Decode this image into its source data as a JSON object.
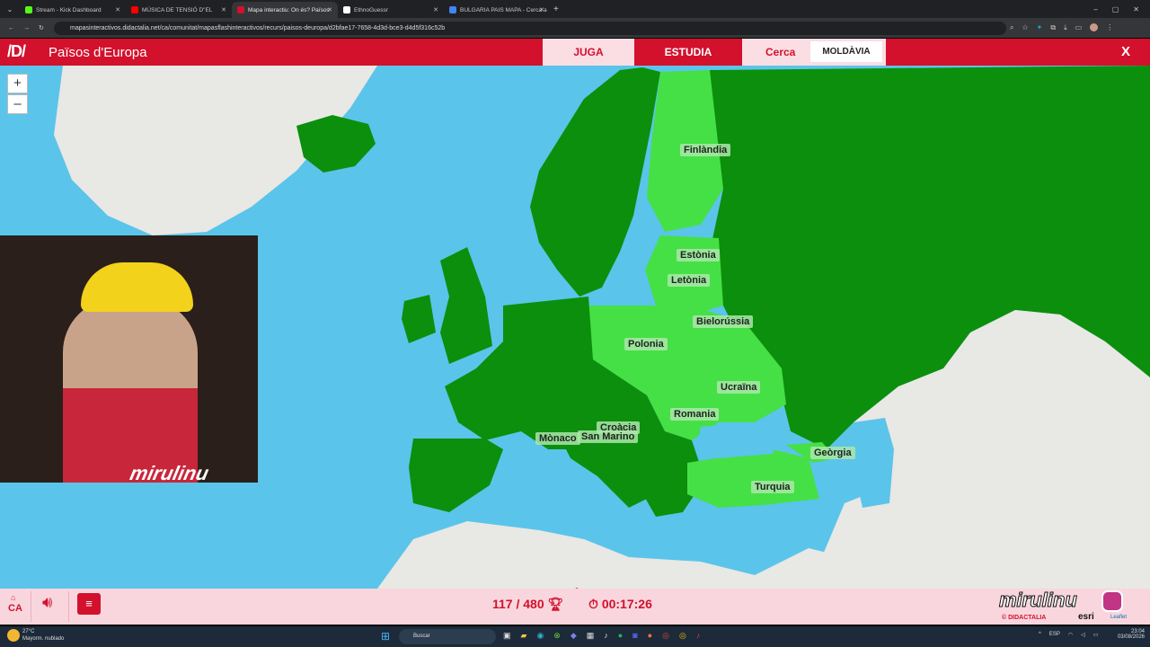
{
  "browser": {
    "tabs": [
      {
        "label": "Stream - Kick Dashboard",
        "color": "#53fc18",
        "active": false
      },
      {
        "label": "MÚSICA DE TENSIÓ D\"EL",
        "color": "#ff0000",
        "active": false
      },
      {
        "label": "Mapa interactiu: On és? Països",
        "color": "#d3112c",
        "active": true
      },
      {
        "label": "EthnoGuessr",
        "color": "#ffffff",
        "active": false
      },
      {
        "label": "BULGARIA PAIS MAPA - Cerca a",
        "color": "#4285f4",
        "active": false
      }
    ],
    "url": "mapasinteractivos.didactalia.net/ca/comunitat/mapasflashinteractivos/recurs/paisos-deuropa/d2bfae17-7658-4d3d-bce3-d4d5f316c52b"
  },
  "header": {
    "logo": "/D/",
    "title": "Països d'Europa",
    "play_label": "JUGA",
    "study_label": "ESTUDIA",
    "search_label": "Cerca",
    "search_value": "MOLDÀVIA",
    "close_label": "X"
  },
  "map": {
    "zoom_in": "+",
    "zoom_out": "–",
    "labels": [
      {
        "name": "Finlàndia"
      },
      {
        "name": "Estònia"
      },
      {
        "name": "Letònia"
      },
      {
        "name": "Bielorússia"
      },
      {
        "name": "Polonia"
      },
      {
        "name": "Ucraïna"
      },
      {
        "name": "Romania"
      },
      {
        "name": "Croàcia"
      },
      {
        "name": "San Marino"
      },
      {
        "name": "Mònaco"
      },
      {
        "name": "Geòrgia"
      },
      {
        "name": "Turquia"
      }
    ],
    "colors": {
      "water": "#5bc4ea",
      "found": "#45e045",
      "country": "#0c8f0c",
      "land": "#e8e8e4"
    }
  },
  "webcam": {
    "overlay_text": "mirulinu"
  },
  "footer": {
    "lang": "CA",
    "score": "117 / 480",
    "time": "00:17:26",
    "brand": "mirulinu",
    "credit_left": "© DIDACTALIA",
    "credit_right": "esri",
    "leaflet": "Leaflet"
  },
  "taskbar": {
    "weather_temp": "27°C",
    "weather_desc": "Mayorm. nublado",
    "search_placeholder": "Buscar",
    "lang": "ESP",
    "time": "23:04",
    "date": "03/08/2026"
  }
}
